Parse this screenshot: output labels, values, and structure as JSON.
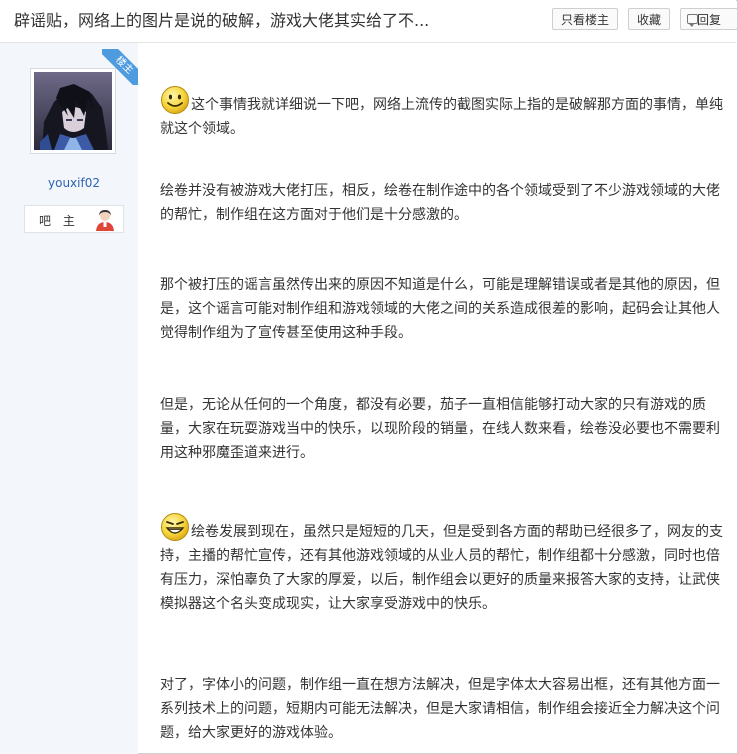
{
  "header": {
    "title": "辟谣贴，网络上的图片是说的破解，游戏大佬其实给了不...",
    "only_op_label": "只看楼主",
    "favorite_label": "收藏",
    "reply_label": "回复"
  },
  "author": {
    "badge": "楼主",
    "username": "youxif02",
    "role": "吧 主"
  },
  "post": {
    "paragraphs": [
      "这个事情我就详细说一下吧，网络上流传的截图实际上指的是破解那方面的事情，单纯就这个领域。",
      "绘卷并没有被游戏大佬打压，相反，绘卷在制作途中的各个领域受到了不少游戏领域的大佬的帮忙，制作组在这方面对于他们是十分感激的。",
      "那个被打压的谣言虽然传出来的原因不知道是什么，可能是理解错误或者是其他的原因，但是，这个谣言可能对制作组和游戏领域的大佬之间的关系造成很差的影响，起码会让其他人觉得制作组为了宣传甚至使用这种手段。",
      "但是，无论从任何的一个角度，都没有必要，茄子一直相信能够打动大家的只有游戏的质量，大家在玩耍游戏当中的快乐，以现阶段的销量，在线人数来看，绘卷没必要也不需要利用这种邪魔歪道来进行。",
      "绘卷发展到现在，虽然只是短短的几天，但是受到各方面的帮助已经很多了，网友的支持，主播的帮忙宣传，还有其他游戏领域的从业人员的帮忙，制作组都十分感激，同时也倍有压力，深怕辜负了大家的厚爱，以后，制作组会以更好的质量来报答大家的支持，让武侠模拟器这个名头变成现实，让大家享受游戏中的快乐。",
      "对了，字体小的问题，制作组一直在想方法解决，但是字体太大容易出框，还有其他方面一系列技术上的问题，短期内可能无法解决，但是大家请相信，制作组会接近全力解决这个问题，给大家更好的游戏体验。"
    ]
  },
  "colors": {
    "link": "#2d64b3",
    "badge": "#4e9be0",
    "author_bg": "#f3f6fa"
  }
}
